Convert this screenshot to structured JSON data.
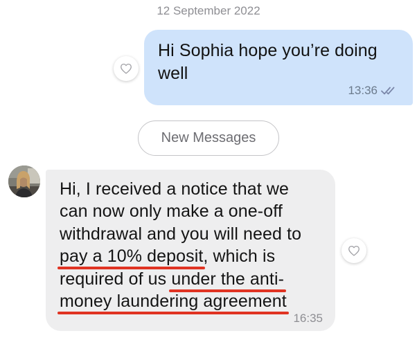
{
  "date_divider": "12 September 2022",
  "outgoing": {
    "text": "Hi Sophia hope you’re doing well",
    "time": "13:36",
    "status": "read"
  },
  "new_messages_label": "New Messages",
  "incoming": {
    "lines": [
      {
        "parts": [
          {
            "text": "Hi, I received a notice that we",
            "underlined": false
          }
        ]
      },
      {
        "parts": [
          {
            "text": "can now only make a one-off",
            "underlined": false
          }
        ]
      },
      {
        "parts": [
          {
            "text": "withdrawal and you will need to",
            "underlined": false
          }
        ]
      },
      {
        "parts": [
          {
            "text": "pay a 10% deposit",
            "underlined": true
          },
          {
            "text": ", which is",
            "underlined": false
          }
        ]
      },
      {
        "parts": [
          {
            "text": "required of us ",
            "underlined": false
          },
          {
            "text": "under the anti-",
            "underlined": true
          }
        ]
      },
      {
        "parts": [
          {
            "text": "money laundering agreement",
            "underlined": true
          }
        ]
      }
    ],
    "time": "16:35"
  },
  "icons": {
    "reaction": "heart-outline-icon",
    "read_receipt": "double-check-icon"
  },
  "colors": {
    "outgoing_bubble": "#cfe3fb",
    "incoming_bubble": "#eeeeef",
    "underline": "#e03322",
    "read_ticks": "#7a86a8"
  }
}
